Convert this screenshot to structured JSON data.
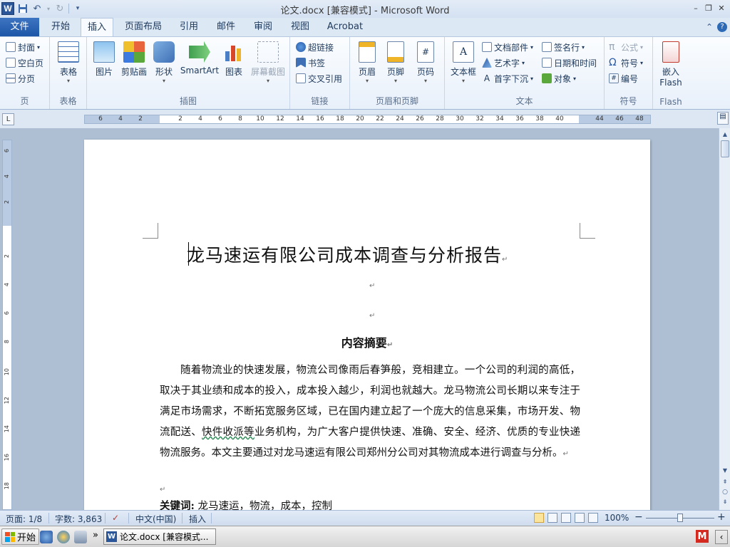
{
  "window": {
    "title": "论文.docx [兼容模式] - Microsoft Word",
    "controls": [
      "–",
      "❐",
      "✕"
    ]
  },
  "quick_access": {
    "app_icon": "W",
    "save_icon": "save-icon",
    "undo_icon": "undo-icon",
    "redo_icon": "redo-icon"
  },
  "tabs": [
    {
      "label": "文件",
      "state": "file"
    },
    {
      "label": "开始"
    },
    {
      "label": "插入",
      "state": "active"
    },
    {
      "label": "页面布局"
    },
    {
      "label": "引用"
    },
    {
      "label": "邮件"
    },
    {
      "label": "审阅"
    },
    {
      "label": "视图"
    },
    {
      "label": "Acrobat"
    }
  ],
  "ribbon": {
    "groups": {
      "pages": {
        "label": "页",
        "items": [
          "封面",
          "空白页",
          "分页"
        ]
      },
      "tables": {
        "label": "表格",
        "items": [
          "表格"
        ]
      },
      "illustrations": {
        "label": "插图",
        "items": [
          "图片",
          "剪贴画",
          "形状",
          "SmartArt",
          "图表",
          "屏幕截图"
        ]
      },
      "links": {
        "label": "链接",
        "items": [
          "超链接",
          "书签",
          "交叉引用"
        ]
      },
      "header_footer": {
        "label": "页眉和页脚",
        "items": [
          "页眉",
          "页脚",
          "页码"
        ]
      },
      "text": {
        "label": "文本",
        "items": [
          "文本框",
          "文档部件",
          "艺术字",
          "首字下沉",
          "签名行",
          "日期和时间",
          "对象"
        ]
      },
      "symbols": {
        "label": "符号",
        "items": [
          "公式",
          "符号",
          "编号"
        ]
      },
      "flash": {
        "label": "Flash",
        "items": [
          "嵌入",
          "Flash"
        ]
      }
    }
  },
  "ruler": {
    "corner": "L",
    "numbers": [
      "6",
      "4",
      "2",
      "2",
      "4",
      "6",
      "8",
      "10",
      "12",
      "14",
      "16",
      "18",
      "20",
      "22",
      "24",
      "26",
      "28",
      "30",
      "32",
      "34",
      "36",
      "38",
      "40",
      "44",
      "46",
      "48"
    ],
    "vertical_numbers": [
      "6",
      "4",
      "2",
      "2",
      "4",
      "6",
      "8",
      "10",
      "12",
      "14",
      "16",
      "18"
    ]
  },
  "document": {
    "title": "龙马速运有限公司成本调查与分析报告",
    "paragraph_mark": "↵",
    "abstract_heading": "内容摘要",
    "abstract_before": "随着物流业的快速发展，物流公司像雨后春笋般，竞相建立。一个公司的利润的高低，取决于其业绩和成本的投入，成本投入越少，利润也就越大。龙马物流公司长期以来专注于满足市场需求，不断拓宽服务区域，已在国内建立起了一个庞大的信息采集，市场开发、物流配送、",
    "abstract_squiggle": "快件收派等",
    "abstract_after": "业务机构，为广大客户提供快速、准确、安全、经济、优质的专业快递物流服务。本文主要通过对龙马速运有限公司郑州分公司对其物流成本进行调查与分析。",
    "keywords_label": "关键词:",
    "keywords_text": "龙马速运，物流，成本，控制"
  },
  "statusbar": {
    "page": "页面: 1/8",
    "word_count": "字数: 3,863",
    "language": "中文(中国)",
    "mode": "插入",
    "zoom": "100%",
    "zoom_minus": "−",
    "zoom_plus": "+"
  },
  "taskbar": {
    "start_label": "开始",
    "task_label": "论文.docx [兼容模式...",
    "more": "»",
    "tray_icon": "M",
    "tray_arrow": "‹"
  }
}
